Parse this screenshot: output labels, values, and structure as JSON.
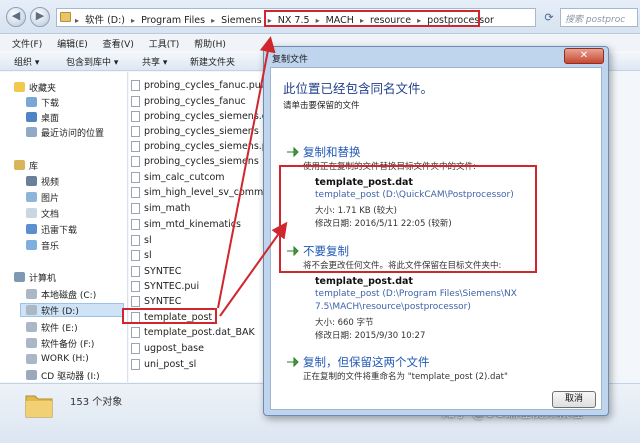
{
  "explorer": {
    "breadcrumbs": [
      "软件 (D:)",
      "Program Files",
      "Siemens",
      "NX 7.5",
      "MACH",
      "resource",
      "postprocessor"
    ],
    "search_placeholder": "搜索 postproc",
    "menu": [
      "文件(F)",
      "编辑(E)",
      "查看(V)",
      "工具(T)",
      "帮助(H)"
    ],
    "toolbar": [
      "组织 ▾",
      "包含到库中 ▾",
      "共享 ▾",
      "新建文件夹"
    ],
    "nav": {
      "favorites": "收藏夹",
      "favorites_items": [
        "下载",
        "桌面",
        "最近访问的位置"
      ],
      "library": "库",
      "library_items": [
        "视频",
        "图片",
        "文档",
        "迅雷下载",
        "音乐"
      ],
      "computer": "计算机",
      "computer_items": [
        "本地磁盘 (C:)",
        "软件 (D:)",
        "软件 (E:)",
        "软件备份 (F:)",
        "WORK (H:)",
        "CD 驱动器 (I:)"
      ]
    },
    "files": [
      "probing_cycles_fanuc.pui",
      "probing_cycles_fanuc",
      "probing_cycles_siemens.cdl",
      "probing_cycles_siemens",
      "probing_cycles_siemens.pui",
      "probing_cycles_siemens",
      "sim_calc_cutcom",
      "sim_high_level_sv_commands",
      "sim_math",
      "sim_mtd_kinematics",
      "sl",
      "sl",
      "SYNTEC",
      "SYNTEC.pui",
      "SYNTEC",
      "template_post",
      "template_post.dat_BAK",
      "ugpost_base",
      "uni_post_sl"
    ],
    "status": "153 个对象"
  },
  "watermark": "知乎 @UG编程视频教程",
  "dialog": {
    "title": "复制文件",
    "close": "✕",
    "heading": "此位置已经包含同名文件。",
    "subheading": "请单击要保留的文件",
    "option1": {
      "title": "复制和替换",
      "desc": "使用正在复制的文件替换目标文件夹中的文件:",
      "file": "template_post.dat",
      "path": "template_post (D:\\QuickCAM\\Postprocessor)",
      "size": "大小: 1.71 KB (较大)",
      "date": "修改日期: 2016/5/11 22:05 (较新)"
    },
    "option2": {
      "title": "不要复制",
      "desc": "将不会更改任何文件。将此文件保留在目标文件夹中:",
      "file": "template_post.dat",
      "path1": "template_post (D:\\Program Files\\Siemens\\NX",
      "path2": "7.5\\MACH\\resource\\postprocessor)",
      "size": "大小: 660 字节",
      "date": "修改日期: 2015/9/30 10:27"
    },
    "option3": {
      "title": "复制，但保留这两个文件",
      "desc": "正在复制的文件将重命名为 \"template_post (2).dat\""
    },
    "cancel": "取消"
  }
}
